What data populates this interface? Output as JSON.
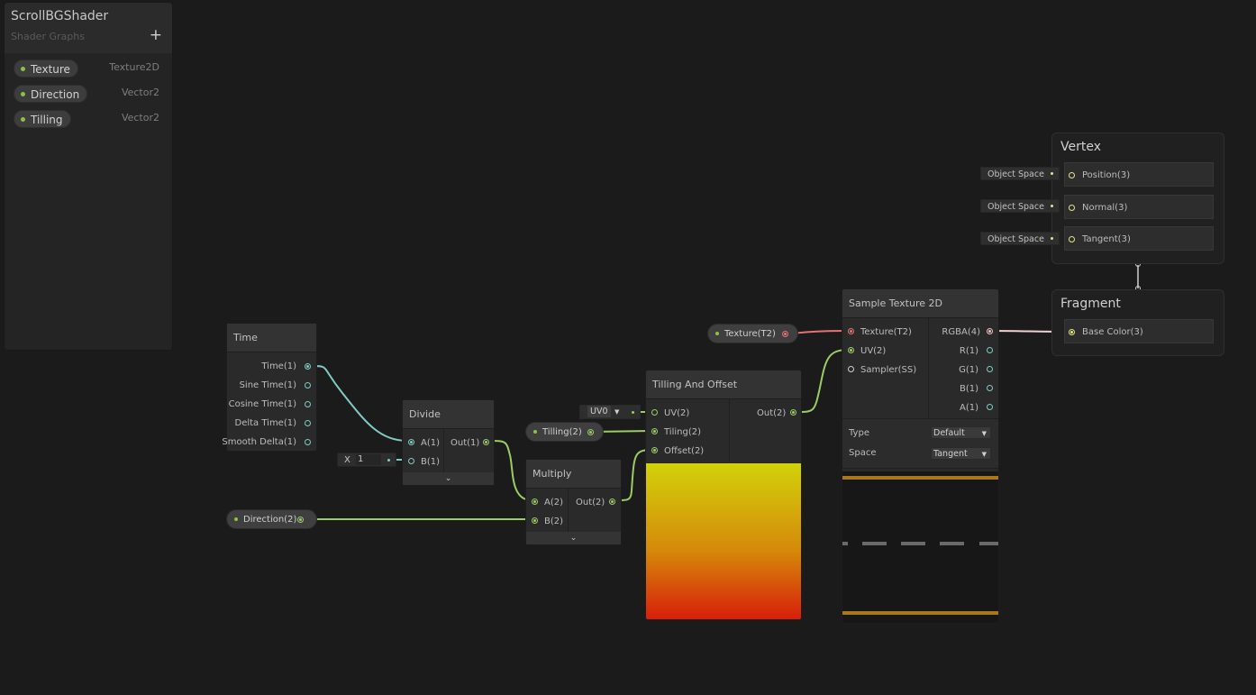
{
  "blackboard": {
    "title": "ScrollBGShader",
    "subtitle": "Shader Graphs",
    "add_label": "+",
    "properties": [
      {
        "name": "Texture",
        "type": "Texture2D"
      },
      {
        "name": "Direction",
        "type": "Vector2"
      },
      {
        "name": "Tilling",
        "type": "Vector2"
      }
    ]
  },
  "time_node": {
    "title": "Time",
    "outputs": [
      "Time(1)",
      "Sine Time(1)",
      "Cosine Time(1)",
      "Delta Time(1)",
      "Smooth Delta(1)"
    ]
  },
  "divide_node": {
    "title": "Divide",
    "inputs": [
      "A(1)",
      "B(1)"
    ],
    "outputs": [
      "Out(1)"
    ],
    "b_field_label": "X",
    "b_field_value": "1"
  },
  "multiply_node": {
    "title": "Multiply",
    "inputs": [
      "A(2)",
      "B(2)"
    ],
    "outputs": [
      "Out(2)"
    ]
  },
  "tiling_offset_node": {
    "title": "Tilling And Offset",
    "inputs": [
      "UV(2)",
      "Tiling(2)",
      "Offset(2)"
    ],
    "outputs": [
      "Out(2)"
    ],
    "uv_dropdown": "UV0"
  },
  "sample_texture_node": {
    "title": "Sample Texture 2D",
    "inputs": [
      "Texture(T2)",
      "UV(2)",
      "Sampler(SS)"
    ],
    "outputs": [
      "RGBA(4)",
      "R(1)",
      "G(1)",
      "B(1)",
      "A(1)"
    ],
    "settings": [
      {
        "label": "Type",
        "value": "Default"
      },
      {
        "label": "Space",
        "value": "Tangent"
      }
    ]
  },
  "property_nodes": {
    "texture": "Texture(T2)",
    "tilling": "Tilling(2)",
    "direction": "Direction(2)"
  },
  "vertex_context": {
    "title": "Vertex",
    "blocks": [
      {
        "label": "Position(3)",
        "space": "Object Space"
      },
      {
        "label": "Normal(3)",
        "space": "Object Space"
      },
      {
        "label": "Tangent(3)",
        "space": "Object Space"
      }
    ]
  },
  "fragment_context": {
    "title": "Fragment",
    "blocks": [
      {
        "label": "Base Color(3)"
      }
    ]
  },
  "colors": {
    "background": "#1b1b1b",
    "vector1_wire": "#80cbc4",
    "vector2_wire": "#9ccc65",
    "texture_wire": "#e57373",
    "vector4_wire": "#f0d0d0",
    "preview_top": "#d2d20a",
    "preview_bottom": "#d81c0a"
  }
}
